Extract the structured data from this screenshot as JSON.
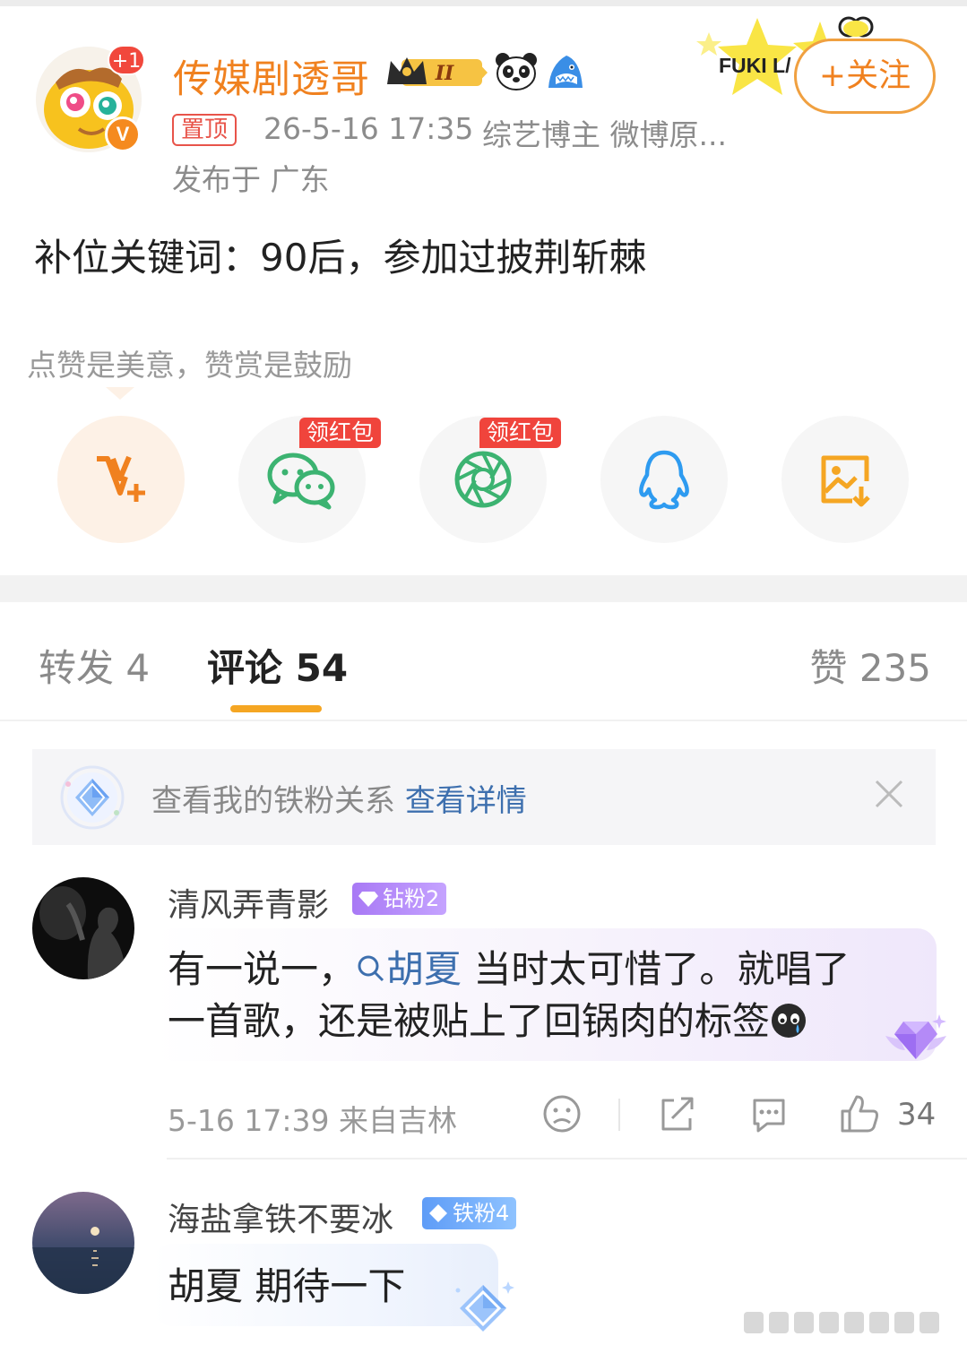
{
  "post": {
    "author": "传媒剧透哥",
    "avatar_badge": "+1",
    "verified_mark": "V",
    "level_badge": "II",
    "pinned_tag": "置顶",
    "time": "26-5-16 17:35",
    "source": "综艺博主 微博原...",
    "location": "发布于 广东",
    "decoration_text": "FUKI L/",
    "follow_label": "+关注",
    "content": "补位关键词：90后，参加过披荆斩棘"
  },
  "reward": {
    "tip": "点赞是美意，赞赏是鼓励",
    "hongbao_label_1": "领红包",
    "hongbao_label_2": "领红包",
    "share_icons": [
      "v-plus-icon",
      "wechat-icon",
      "moments-icon",
      "qq-icon",
      "save-image-icon"
    ]
  },
  "tabs": {
    "repost": "转发 4",
    "comment": "评论 54",
    "like": "赞 235"
  },
  "banner": {
    "text": "查看我的铁粉关系",
    "link": "查看详情"
  },
  "comments": [
    {
      "name": "清风弄青影",
      "badge": "钻粉2",
      "text_line1_a": "有一说一，",
      "topic": "胡夏",
      "text_line1_b": " 当时太可惜了。就唱了",
      "text_line2": "一首歌，还是被贴上了回锅肉的标签",
      "time_loc": "5-16 17:39  来自吉林",
      "likes": "34"
    },
    {
      "name": "海盐拿铁不要冰",
      "badge": "铁粉4",
      "text": "胡夏 期待一下"
    }
  ],
  "colors": {
    "accent_orange": "#f0811f",
    "link_blue": "#3d6fae",
    "hongbao_red": "#f0443c",
    "tab_underline": "#f5a623"
  }
}
